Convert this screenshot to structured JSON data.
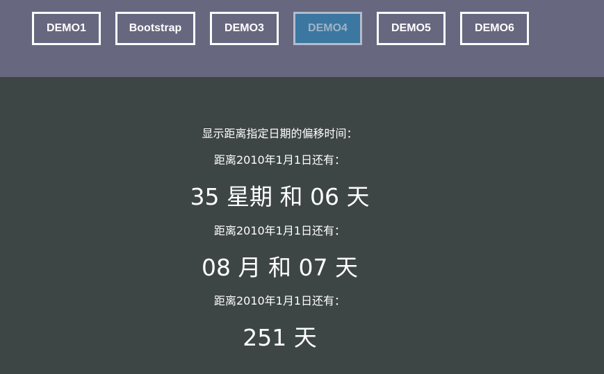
{
  "nav": {
    "items": [
      {
        "label": "DEMO1"
      },
      {
        "label": "Bootstrap"
      },
      {
        "label": "DEMO3"
      },
      {
        "label": "DEMO4"
      },
      {
        "label": "DEMO5"
      },
      {
        "label": "DEMO6"
      }
    ],
    "active_index": 3
  },
  "content": {
    "intro": "显示距离指定日期的偏移时间：",
    "blocks": [
      {
        "label": "距离2010年1月1日还有：",
        "value": "35 星期 和 06 天"
      },
      {
        "label": "距离2010年1月1日还有：",
        "value": "08 月 和 07 天"
      },
      {
        "label": "距离2010年1月1日还有：",
        "value": "251 天"
      }
    ]
  },
  "colors": {
    "header_bg": "#676780",
    "body_bg": "#3e4545",
    "active_button_bg": "#3b77a0"
  }
}
